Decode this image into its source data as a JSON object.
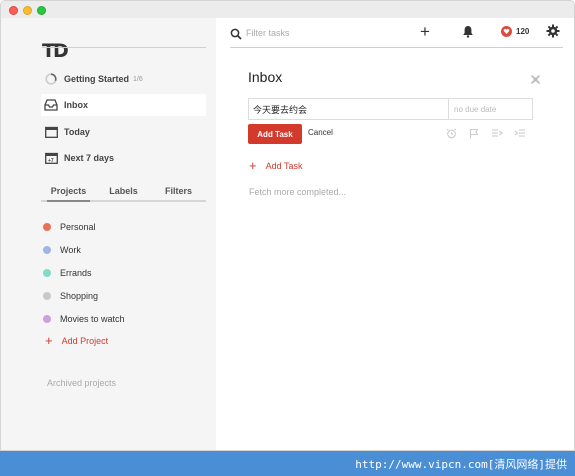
{
  "app": {
    "logo": "TD"
  },
  "sidebar": {
    "nav": [
      {
        "label": "Getting Started",
        "count": "1/6",
        "icon": "progress-ring-icon"
      },
      {
        "label": "Inbox",
        "icon": "inbox-icon"
      },
      {
        "label": "Today",
        "icon": "calendar-icon"
      },
      {
        "label": "Next 7 days",
        "icon": "calendar-week-icon",
        "badge": "+7"
      }
    ],
    "tabs": [
      "Projects",
      "Labels",
      "Filters"
    ],
    "projects": [
      {
        "label": "Personal",
        "color": "#e8735a"
      },
      {
        "label": "Work",
        "color": "#9db7e2"
      },
      {
        "label": "Errands",
        "color": "#7fdcc7"
      },
      {
        "label": "Shopping",
        "color": "#c8c8c8"
      },
      {
        "label": "Movies to watch",
        "color": "#d39be0"
      }
    ],
    "add_project": "Add Project",
    "archived": "Archived projects"
  },
  "topbar": {
    "search_placeholder": "Filter tasks",
    "karma": "120"
  },
  "main": {
    "title": "Inbox",
    "task_value": "今天要去约会",
    "due_placeholder": "no due date",
    "add_task_button": "Add Task",
    "cancel": "Cancel",
    "add_task_link": "Add Task",
    "fetch_more": "Fetch more completed..."
  },
  "footer": {
    "watermark": "http://www.vipcn.com[清风网络]提供"
  },
  "colors": {
    "accent": "#d33a2c",
    "footer": "#4a8fd6"
  }
}
